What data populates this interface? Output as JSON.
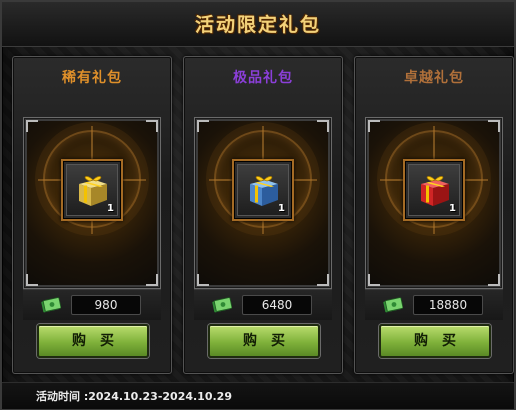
{
  "window": {
    "title": "活动限定礼包"
  },
  "packs": [
    {
      "name": "稀有礼包",
      "title_color": "#e0902a",
      "gift_color": "gold",
      "quantity": "1",
      "price": "980",
      "buy_label": "购买"
    },
    {
      "name": "极品礼包",
      "title_color": "#8b3fd9",
      "gift_color": "blue",
      "quantity": "1",
      "price": "6480",
      "buy_label": "购买"
    },
    {
      "name": "卓越礼包",
      "title_color": "#b0703a",
      "gift_color": "red",
      "quantity": "1",
      "price": "18880",
      "buy_label": "购买"
    }
  ],
  "footer": {
    "event_time": "活动时间 :2024.10.23-2024.10.29"
  },
  "icons": {
    "currency": "cash-icon",
    "item": "gift-box-icon"
  }
}
